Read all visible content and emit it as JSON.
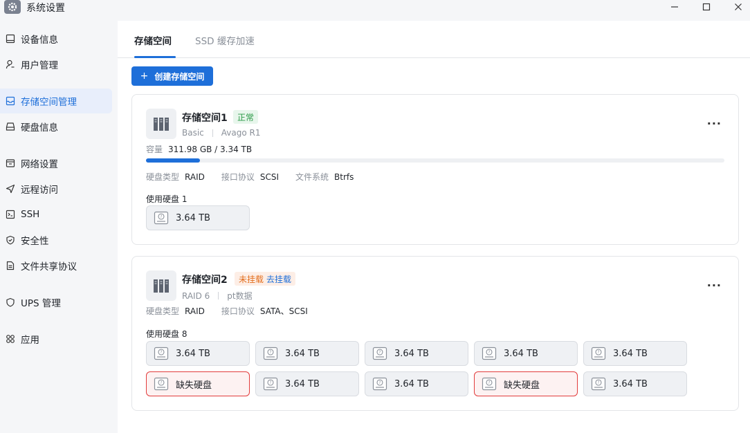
{
  "window": {
    "title": "系统设置",
    "minimize_label": "—",
    "maximize_label": "☐",
    "close_label": "✕"
  },
  "sidebar": {
    "items": [
      {
        "label": "设备信息",
        "icon": "device-icon"
      },
      {
        "label": "用户管理",
        "icon": "user-icon"
      },
      {
        "label": "存储空间管理",
        "icon": "storage-icon",
        "active": true
      },
      {
        "label": "硬盘信息",
        "icon": "disk-icon"
      },
      {
        "label": "网络设置",
        "icon": "network-icon"
      },
      {
        "label": "远程访问",
        "icon": "send-icon"
      },
      {
        "label": "SSH",
        "icon": "terminal-icon"
      },
      {
        "label": "安全性",
        "icon": "shield-icon"
      },
      {
        "label": "文件共享协议",
        "icon": "file-icon"
      },
      {
        "label": "UPS 管理",
        "icon": "ups-shield-icon"
      },
      {
        "label": "应用",
        "icon": "apps-icon"
      }
    ]
  },
  "tabs": [
    {
      "label": "存储空间",
      "active": true
    },
    {
      "label": "SSD 缓存加速",
      "active": false
    }
  ],
  "create_button": {
    "plus": "+",
    "label": "创建存储空间"
  },
  "pools": [
    {
      "name": "存储空间1",
      "status": "正常",
      "sub": [
        "Basic",
        "Avago R1"
      ],
      "capacity_label": "容量",
      "capacity_value": "311.98 GB / 3.34 TB",
      "usage_fraction": 0.093,
      "specs": [
        {
          "k": "硬盘类型",
          "v": "RAID"
        },
        {
          "k": "接口协议",
          "v": "SCSI"
        },
        {
          "k": "文件系统",
          "v": "Btrfs"
        }
      ],
      "disks_label": "使用硬盘 1",
      "disks": [
        {
          "label": "3.64 TB",
          "missing": false
        }
      ]
    },
    {
      "name": "存储空间2",
      "status": "未挂载",
      "status_link": "去挂载",
      "sub": [
        "RAID 6",
        "pt数据"
      ],
      "specs": [
        {
          "k": "硬盘类型",
          "v": "RAID"
        },
        {
          "k": "接口协议",
          "v": "SATA、SCSI"
        }
      ],
      "disks_label": "使用硬盘 8",
      "disks": [
        {
          "label": "3.64 TB",
          "missing": false
        },
        {
          "label": "3.64 TB",
          "missing": false
        },
        {
          "label": "3.64 TB",
          "missing": false
        },
        {
          "label": "3.64 TB",
          "missing": false
        },
        {
          "label": "3.64 TB",
          "missing": false
        },
        {
          "label": "缺失硬盘",
          "missing": true
        },
        {
          "label": "3.64 TB",
          "missing": false
        },
        {
          "label": "3.64 TB",
          "missing": false
        },
        {
          "label": "缺失硬盘",
          "missing": true
        },
        {
          "label": "3.64 TB",
          "missing": false
        }
      ]
    }
  ],
  "more_label": "···",
  "colors": {
    "accent": "#1e6fd9",
    "ok": "#2b9a47",
    "warn": "#e36f1e",
    "missing_border": "#e23b3b"
  }
}
